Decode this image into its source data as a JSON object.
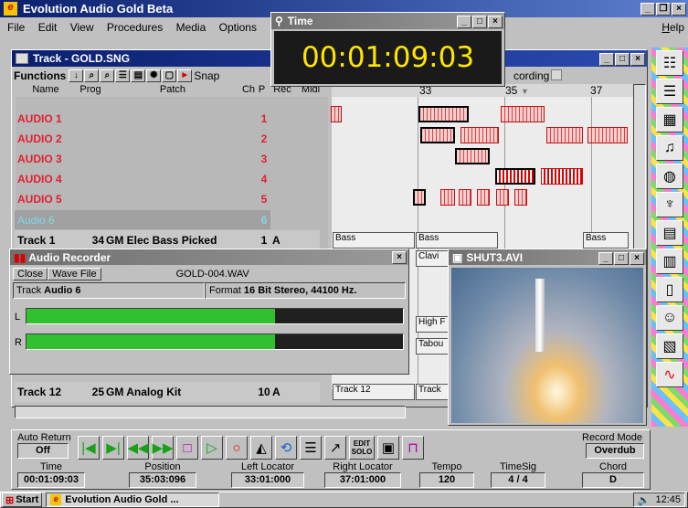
{
  "app": {
    "title": "Evolution Audio Gold Beta",
    "icon": "e"
  },
  "menu": [
    "File",
    "Edit",
    "View",
    "Procedures",
    "Media",
    "Options",
    "Help"
  ],
  "time_window": {
    "title": "Time",
    "time": "00:01:09:03"
  },
  "track_window": {
    "title": "Track - GOLD.SNG",
    "functions_label": "Functions",
    "snap_label": "Snap",
    "recording_label": "cording",
    "columns": [
      "Name",
      "Prog",
      "Patch",
      "Ch",
      "P",
      "Rec",
      "Midi"
    ],
    "ruler": [
      "33",
      "35",
      "37"
    ],
    "rows": [
      {
        "name": "AUDIO 1",
        "prog": "",
        "patch": "",
        "ch": "1",
        "p": ""
      },
      {
        "name": "AUDIO 2",
        "prog": "",
        "patch": "",
        "ch": "2",
        "p": ""
      },
      {
        "name": "AUDIO 3",
        "prog": "",
        "patch": "",
        "ch": "3",
        "p": ""
      },
      {
        "name": "AUDIO 4",
        "prog": "",
        "patch": "",
        "ch": "4",
        "p": ""
      },
      {
        "name": "AUDIO 5",
        "prog": "",
        "patch": "",
        "ch": "5",
        "p": ""
      },
      {
        "name": "Audio 6",
        "prog": "",
        "patch": "",
        "ch": "6",
        "p": ""
      },
      {
        "name": "Track 1",
        "prog": "34",
        "patch": "GM Elec Bass Picked",
        "ch": "1",
        "p": "A"
      }
    ],
    "row12": {
      "name": "Track 12",
      "prog": "25",
      "patch": "GM Analog Kit",
      "ch": "10",
      "p": "A"
    },
    "lane_labels": {
      "bass1": "Bass",
      "bass2": "Bass",
      "bass3": "Bass",
      "clavi": "Clavi",
      "highf": "High F",
      "tabou": "Tabou",
      "track12a": "Track 12",
      "track12b": "Track"
    }
  },
  "audio_recorder": {
    "title": "Audio Recorder",
    "close_label": "Close",
    "wavefile_label": "Wave File",
    "file": "GOLD-004.WAV",
    "track_prefix": "Track",
    "track_name": "Audio 6",
    "format_prefix": "Format",
    "format": "16 Bit Stereo, 44100 Hz.",
    "channel_l": "L",
    "channel_r": "R",
    "level_l": 0.66,
    "level_r": 0.66
  },
  "video_window": {
    "title": "SHUT3.AVI"
  },
  "transport": {
    "auto_return_label": "Auto Return",
    "auto_return_value": "Off",
    "record_mode_label": "Record Mode",
    "record_mode_value": "Overdub",
    "edit_solo": "EDIT SOLO",
    "fields": [
      {
        "label": "Time",
        "value": "00:01:09:03"
      },
      {
        "label": "Position",
        "value": "35:03:096"
      },
      {
        "label": "Left Locator",
        "value": "33:01:000"
      },
      {
        "label": "Right Locator",
        "value": "37:01:000"
      },
      {
        "label": "Tempo",
        "value": "120"
      },
      {
        "label": "TimeSig",
        "value": "4 / 4"
      },
      {
        "label": "Chord",
        "value": "D"
      }
    ]
  },
  "taskbar": {
    "start": "Start",
    "task": "Evolution Audio Gold ...",
    "clock": "12:45"
  },
  "colors": {
    "title_blue": "#0a1f6e",
    "time_digits": "#ffe600",
    "track_red": "#e02030",
    "meter_green": "#30c030"
  }
}
